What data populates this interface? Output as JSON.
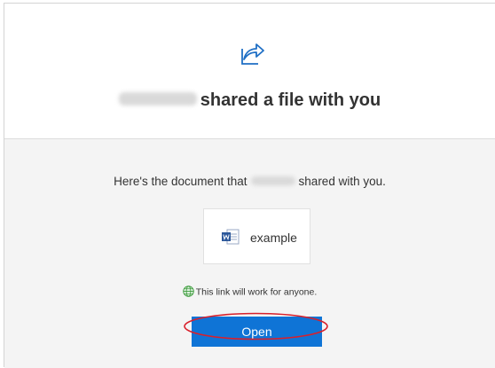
{
  "header": {
    "icon": "share-arrow-icon",
    "sender_name_redacted": "",
    "headline_text": "shared a file with you"
  },
  "body": {
    "intro_prefix": "Here's the document that",
    "intro_suffix": "shared with you.",
    "file": {
      "icon": "word-document-icon",
      "name": "example"
    },
    "notice_icon": "globe-icon",
    "notice_text": "This link will work for anyone.",
    "open_button_label": "Open"
  },
  "colors": {
    "accent": "#0f74d6",
    "share_icon": "#1f6fc5",
    "word_blue": "#2b579a",
    "globe_green": "#3a9a3a",
    "highlight_ellipse": "#d9202b",
    "body_background": "#f4f4f4"
  }
}
